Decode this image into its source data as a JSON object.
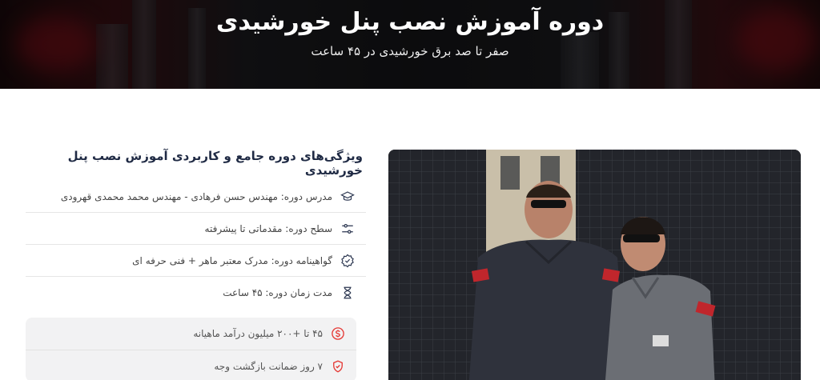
{
  "hero": {
    "title": "دوره آموزش نصب پنل خورشیدی",
    "subtitle": "صفر تا صد برق خورشیدی در ۴۵ ساعت"
  },
  "features": {
    "title": "ویژگی‌های دوره جامع و کاربردی آموزش نصب پنل خورشیدی",
    "items": [
      {
        "icon": "graduation-cap-icon",
        "text": "مدرس دوره: مهندس حسن فرهادی - مهندس محمد محمدی قهرودی"
      },
      {
        "icon": "sliders-icon",
        "text": "سطح دوره: مقدماتی تا پیشرفته"
      },
      {
        "icon": "badge-check-icon",
        "text": "گواهینامه دوره: مدرک معتبر ماهر + فنی حرفه ای"
      },
      {
        "icon": "hourglass-icon",
        "text": "مدت زمان دوره: ۴۵ ساعت"
      }
    ]
  },
  "promo": {
    "items": [
      {
        "icon": "dollar-circle-icon",
        "text": "۴۵ تا +۲۰۰ میلیون درآمد ماهیانه"
      },
      {
        "icon": "shield-check-icon",
        "text": "۷ روز ضمانت بازگشت وجه"
      }
    ]
  },
  "colors": {
    "accent": "#e53935",
    "title": "#1f2a44"
  }
}
